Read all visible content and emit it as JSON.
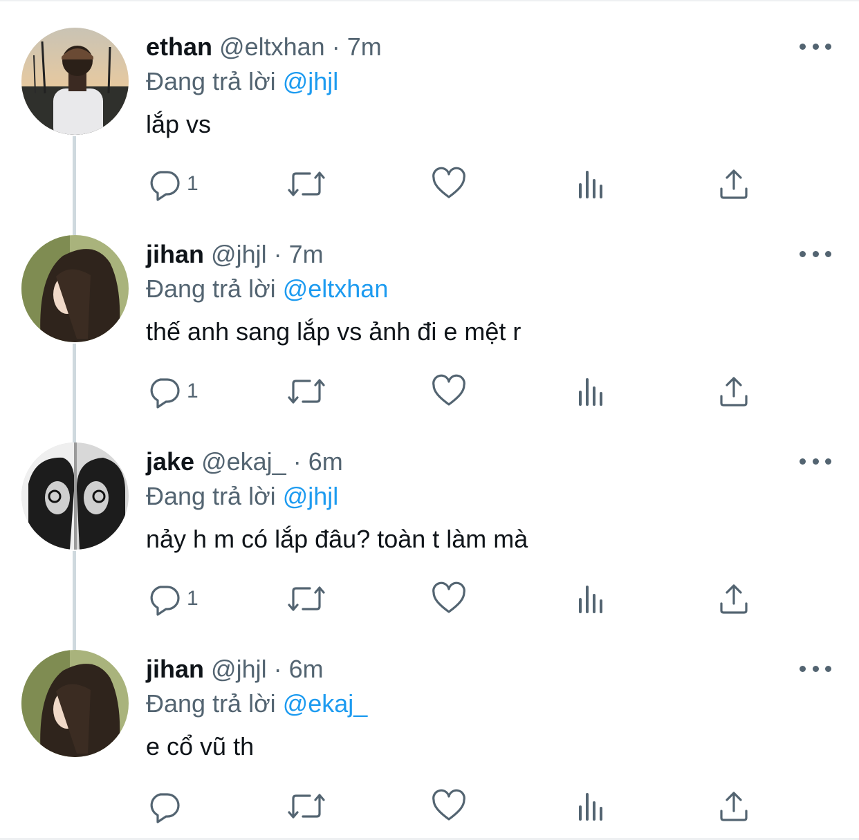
{
  "tweets": [
    {
      "name": "ethan",
      "handle": "@eltxhan",
      "separator": "·",
      "time": "7m",
      "reply_prefix": "Đang trả lời",
      "reply_to": "@jhjl",
      "text": "lắp vs",
      "reply_count": "1",
      "avatar": "man-photo-avatar"
    },
    {
      "name": "jihan",
      "handle": "@jhjl",
      "separator": "·",
      "time": "7m",
      "reply_prefix": "Đang trả lời",
      "reply_to": "@eltxhan",
      "text": "thế anh sang lắp vs ảnh đi e mệt r",
      "reply_count": "1",
      "avatar": "woman-photo-avatar"
    },
    {
      "name": "jake",
      "handle": "@ekaj_",
      "separator": "·",
      "time": "6m",
      "reply_prefix": "Đang trả lời",
      "reply_to": "@jhjl",
      "text": "nảy h m có lắp đâu? toàn t làm mà",
      "reply_count": "1",
      "avatar": "bw-portrait-avatar"
    },
    {
      "name": "jihan",
      "handle": "@jhjl",
      "separator": "·",
      "time": "6m",
      "reply_prefix": "Đang trả lời",
      "reply_to": "@ekaj_",
      "text": "e cổ vũ th",
      "reply_count": "",
      "avatar": "woman-photo-avatar"
    }
  ],
  "icons": [
    "reply-icon",
    "retweet-icon",
    "like-icon",
    "views-icon",
    "share-icon",
    "more-icon"
  ],
  "colors": {
    "text": "#0f1419",
    "secondary": "#536471",
    "mention": "#1d9bf0",
    "thread_line": "#cfd9de"
  }
}
